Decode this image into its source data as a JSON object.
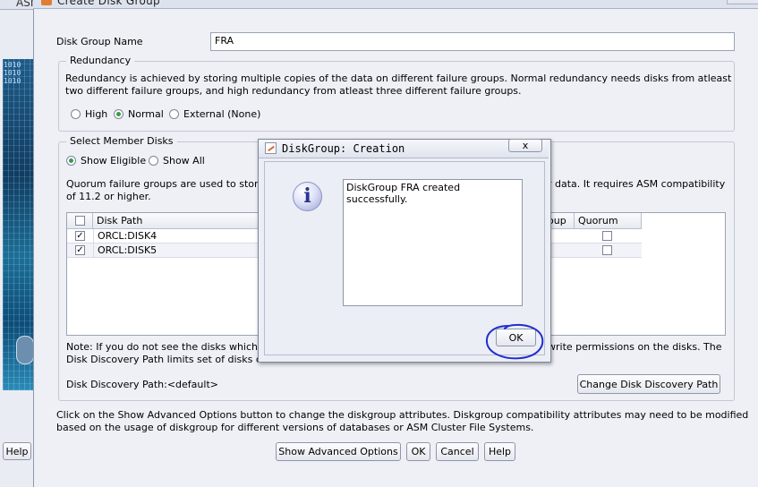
{
  "background_window": {
    "title": "ASM",
    "art_digits": [
      "1010",
      "1010",
      "1010"
    ],
    "help_label": "Help"
  },
  "dialog": {
    "title": "Create Disk Group",
    "disk_group_name_label": "Disk Group Name",
    "disk_group_name_value": "FRA",
    "redundancy": {
      "legend": "Redundancy",
      "description_line1": "Redundancy is achieved by storing multiple copies of the data on different failure groups. Normal redundancy needs disks from atleast",
      "description_line2": "two different failure groups, and high redundancy from atleast three different failure groups.",
      "options": [
        "High",
        "Normal",
        "External (None)"
      ],
      "selected": "Normal"
    },
    "member_disks": {
      "legend": "Select Member Disks",
      "filter_options": [
        "Show Eligible",
        "Show All"
      ],
      "selected_filter": "Show Eligible",
      "quorum_note_left": "Quorum failure groups are used to stor",
      "quorum_note_right": "r data. It requires ASM compatibility",
      "quorum_note_line2": "of 11.2 or higher.",
      "columns": {
        "disk_path": "Disk Path",
        "failure_group_tail": "oup",
        "quorum": "Quorum"
      },
      "rows": [
        {
          "disk_path": "ORCL:DISK4",
          "selected": true,
          "quorum": false
        },
        {
          "disk_path": "ORCL:DISK5",
          "selected": true,
          "quorum": false
        }
      ],
      "note_left": "Note: If you do not see the disks which y",
      "note_right": "write permissions on the disks. The",
      "note_line2": "Disk Discovery Path limits set of disks co",
      "discovery_path_label": "Disk Discovery Path:<default>",
      "change_path_button": "Change Disk Discovery Path"
    },
    "advanced_note_line1": "Click on the Show Advanced Options button to change the diskgroup attributes. Diskgroup compatibility attributes may need to be modified",
    "advanced_note_line2": "based on the usage of diskgroup for different versions of databases or ASM Cluster File Systems.",
    "buttons": {
      "show_advanced": "Show Advanced Options",
      "ok": "OK",
      "cancel": "Cancel",
      "help": "Help"
    }
  },
  "modal": {
    "title": "DiskGroup: Creation",
    "message": "DiskGroup FRA created successfully.",
    "ok_label": "OK",
    "close_label": "x"
  },
  "colors": {
    "annotation_circle": "#1f2fd0",
    "radio_selected": "#3a9a4a"
  }
}
